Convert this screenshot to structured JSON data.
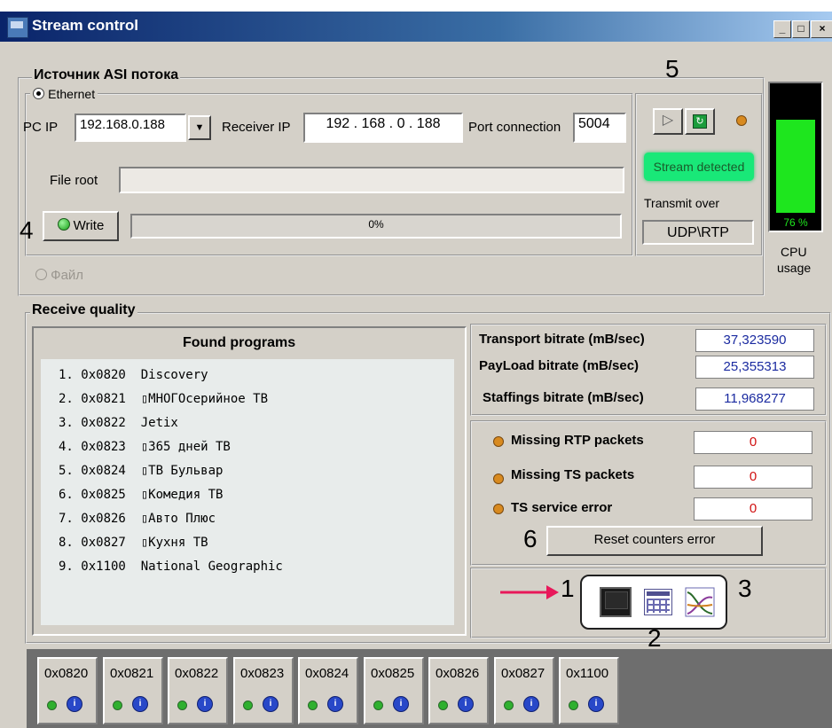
{
  "window": {
    "title": "Stream control",
    "minimize_label": "_",
    "maximize_label": "□",
    "close_label": "×"
  },
  "asi": {
    "group_title": "Источник ASI потока",
    "ethernet_label": "Ethernet",
    "pc_ip_label": "PC IP",
    "pc_ip_value": "192.168.0.188",
    "receiver_ip_label": "Receiver IP",
    "receiver_ip_value": "192 . 168 .   0  . 188",
    "port_label": "Port connection",
    "port_value": "5004",
    "file_root_label": "File root",
    "file_root_value": "",
    "write_label": "Write",
    "progress_text": "0%",
    "progress": 0,
    "file_label": "Файл"
  },
  "stream": {
    "status": "Stream detected",
    "transmit_label": "Transmit over",
    "transmit_value": "UDP\\RTP",
    "play_icon": "play-icon",
    "refresh_icon": "refresh-icon"
  },
  "cpu": {
    "percent_text": "76 %",
    "percent": 76,
    "label_line1": "CPU",
    "label_line2": "usage"
  },
  "quality": {
    "group_title": "Receive  quality",
    "found_programs_title": "Found programs",
    "programs": [
      "1. 0x0820  Discovery",
      "2. 0x0821  ▯МНОГОсерийное ТВ",
      "3. 0x0822  Jetix",
      "4. 0x0823  ▯365 дней ТВ",
      "5. 0x0824  ▯ТВ Бульвар",
      "6. 0x0825  ▯Комедия ТВ",
      "7. 0x0826  ▯Авто Плюс",
      "8. 0x0827  ▯Кухня ТВ",
      "9. 0x1100  National Geographic"
    ],
    "bitrates": [
      {
        "label": "Transport bitrate (mB/sec)",
        "value": "37,323590"
      },
      {
        "label": "PayLoad bitrate  (mB/sec)",
        "value": "25,355313"
      },
      {
        "label": "Staffings bitrate  (mB/sec)",
        "value": "11,968277"
      }
    ],
    "errors": [
      {
        "label": "Missing RTP packets",
        "value": "0"
      },
      {
        "label": "Missing TS  packets",
        "value": "0"
      },
      {
        "label": "TS service error",
        "value": "0"
      }
    ],
    "reset_label": "Reset counters error"
  },
  "annotations": {
    "n1": "1",
    "n2": "2",
    "n3": "3",
    "n4": "4",
    "n5": "5",
    "n6": "6"
  },
  "view_icons": [
    "monitor-icon",
    "table-icon",
    "graph-icon"
  ],
  "pid_tiles": [
    "0x0820",
    "0x0821",
    "0x0822",
    "0x0823",
    "0x0824",
    "0x0825",
    "0x0826",
    "0x0827",
    "0x1100"
  ],
  "colors": {
    "status_green": "#19e878",
    "cpu_green": "#1ee61e",
    "value_blue": "#1a2aa0",
    "error_red": "#d01010",
    "arrow_red": "#e8185a"
  }
}
